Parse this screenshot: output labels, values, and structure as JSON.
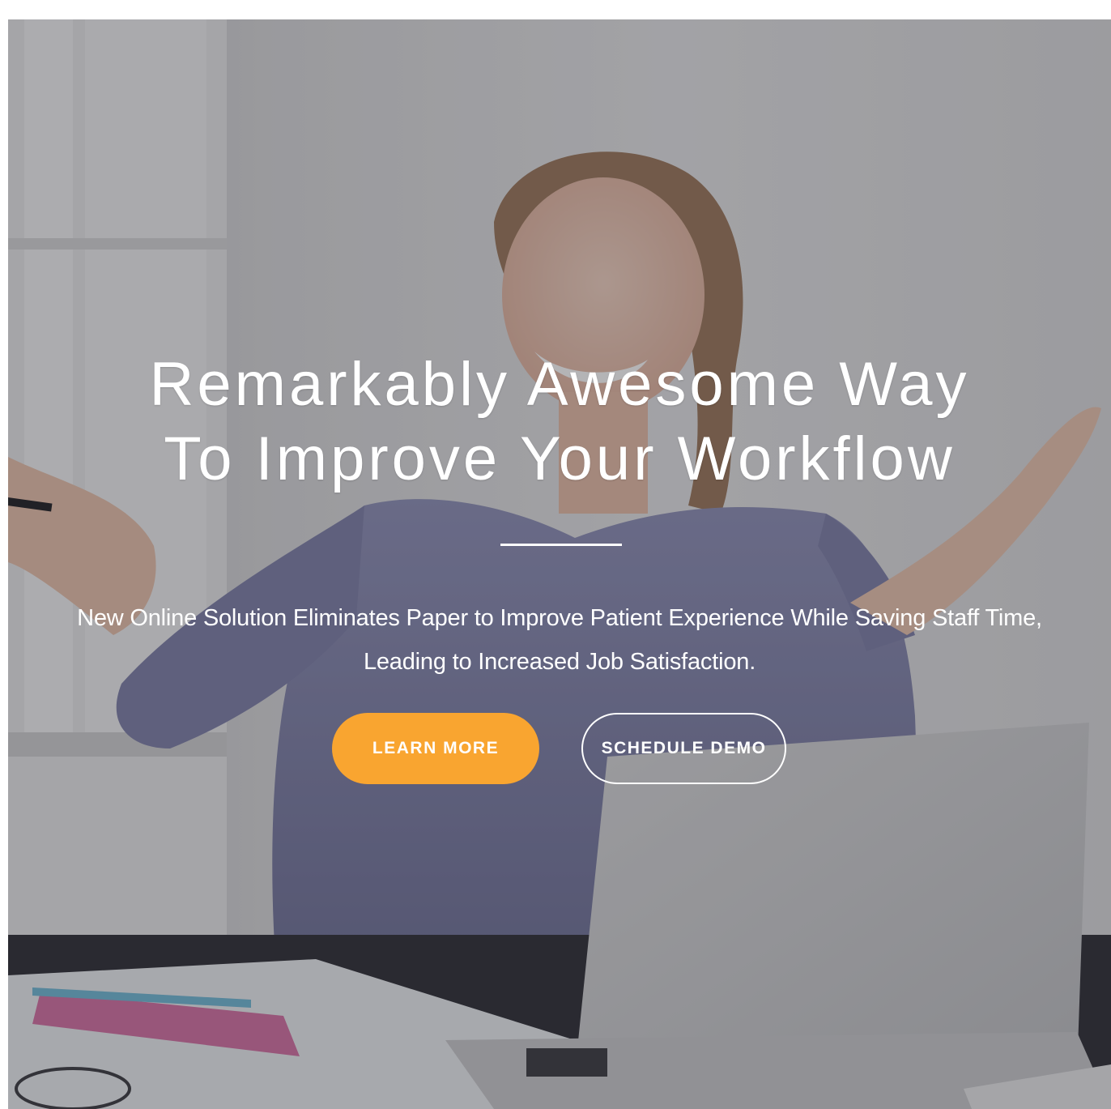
{
  "hero": {
    "title_line1": "Remarkably Awesome Way",
    "title_line2": "To Improve Your Workflow",
    "subtitle": "New Online Solution Eliminates Paper to Improve Patient Experience While Saving Staff Time, Leading to Increased Job Satisfaction.",
    "primary_button": "LEARN MORE",
    "secondary_button": "SCHEDULE DEMO",
    "accent_color": "#f9a530"
  }
}
